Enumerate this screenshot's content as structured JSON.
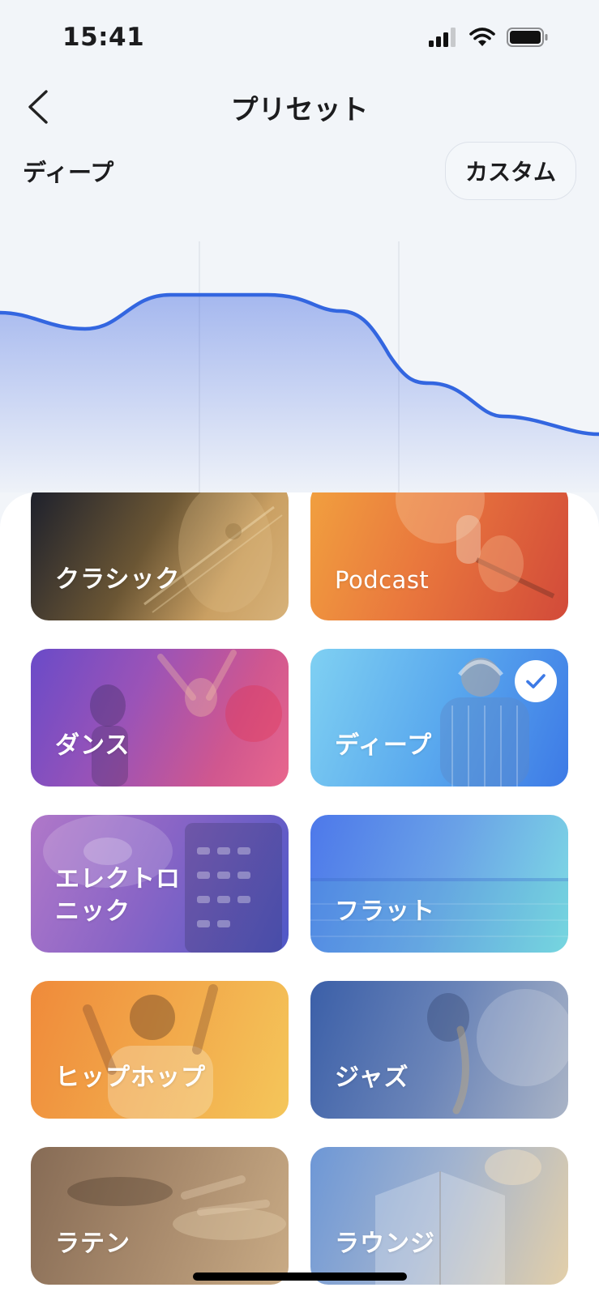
{
  "status_bar": {
    "time": "15:41"
  },
  "nav": {
    "title": "プリセット"
  },
  "current_preset": "ディープ",
  "custom_button": "カスタム",
  "accent_color": "#3366e0",
  "presets": [
    {
      "label": "クラシック",
      "selected": false,
      "gradient": [
        "#1b1f2c",
        "#caa063"
      ]
    },
    {
      "label": "Podcast",
      "selected": false,
      "gradient": [
        "#ef9a3d",
        "#d74a3a"
      ]
    },
    {
      "label": "ダンス",
      "selected": false,
      "gradient": [
        "#6a4bc8",
        "#e85f8f"
      ]
    },
    {
      "label": "ディープ",
      "selected": true,
      "gradient": [
        "#7fd0f2",
        "#3d7ae6"
      ]
    },
    {
      "label": "エレクトロ\nニック",
      "selected": false,
      "gradient": [
        "#a26fc9",
        "#4f58c7"
      ]
    },
    {
      "label": "フラット",
      "selected": false,
      "gradient": [
        "#4d78ea",
        "#7fdde4"
      ]
    },
    {
      "label": "ヒップホップ",
      "selected": false,
      "gradient": [
        "#ef8a3a",
        "#f4c65a"
      ]
    },
    {
      "label": "ジャズ",
      "selected": false,
      "gradient": [
        "#3b5fa8",
        "#aab4c6"
      ]
    },
    {
      "label": "ラテン",
      "selected": false,
      "gradient": [
        "#866b55",
        "#c9ab85"
      ]
    },
    {
      "label": "ラウンジ",
      "selected": false,
      "gradient": [
        "#6d97d6",
        "#e3cfa9"
      ]
    }
  ]
}
